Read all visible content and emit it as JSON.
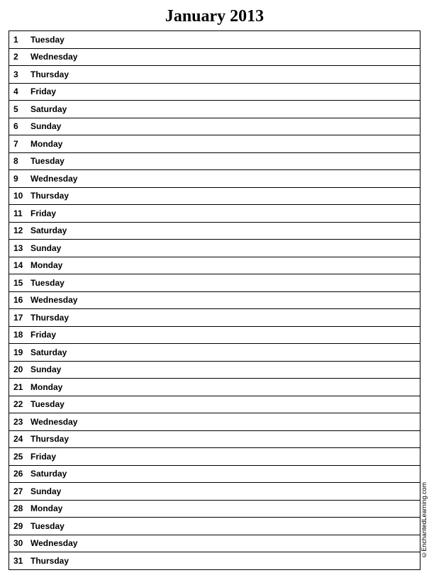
{
  "title": "January 2013",
  "copyright": "©EnchantedLearning.com",
  "days": [
    {
      "num": "1",
      "name": "Tuesday"
    },
    {
      "num": "2",
      "name": "Wednesday"
    },
    {
      "num": "3",
      "name": "Thursday"
    },
    {
      "num": "4",
      "name": "Friday"
    },
    {
      "num": "5",
      "name": "Saturday"
    },
    {
      "num": "6",
      "name": "Sunday"
    },
    {
      "num": "7",
      "name": "Monday"
    },
    {
      "num": "8",
      "name": "Tuesday"
    },
    {
      "num": "9",
      "name": "Wednesday"
    },
    {
      "num": "10",
      "name": "Thursday"
    },
    {
      "num": "11",
      "name": "Friday"
    },
    {
      "num": "12",
      "name": "Saturday"
    },
    {
      "num": "13",
      "name": "Sunday"
    },
    {
      "num": "14",
      "name": "Monday"
    },
    {
      "num": "15",
      "name": "Tuesday"
    },
    {
      "num": "16",
      "name": "Wednesday"
    },
    {
      "num": "17",
      "name": "Thursday"
    },
    {
      "num": "18",
      "name": "Friday"
    },
    {
      "num": "19",
      "name": "Saturday"
    },
    {
      "num": "20",
      "name": "Sunday"
    },
    {
      "num": "21",
      "name": "Monday"
    },
    {
      "num": "22",
      "name": "Tuesday"
    },
    {
      "num": "23",
      "name": "Wednesday"
    },
    {
      "num": "24",
      "name": "Thursday"
    },
    {
      "num": "25",
      "name": "Friday"
    },
    {
      "num": "26",
      "name": "Saturday"
    },
    {
      "num": "27",
      "name": "Sunday"
    },
    {
      "num": "28",
      "name": "Monday"
    },
    {
      "num": "29",
      "name": "Tuesday"
    },
    {
      "num": "30",
      "name": "Wednesday"
    },
    {
      "num": "31",
      "name": "Thursday"
    }
  ]
}
